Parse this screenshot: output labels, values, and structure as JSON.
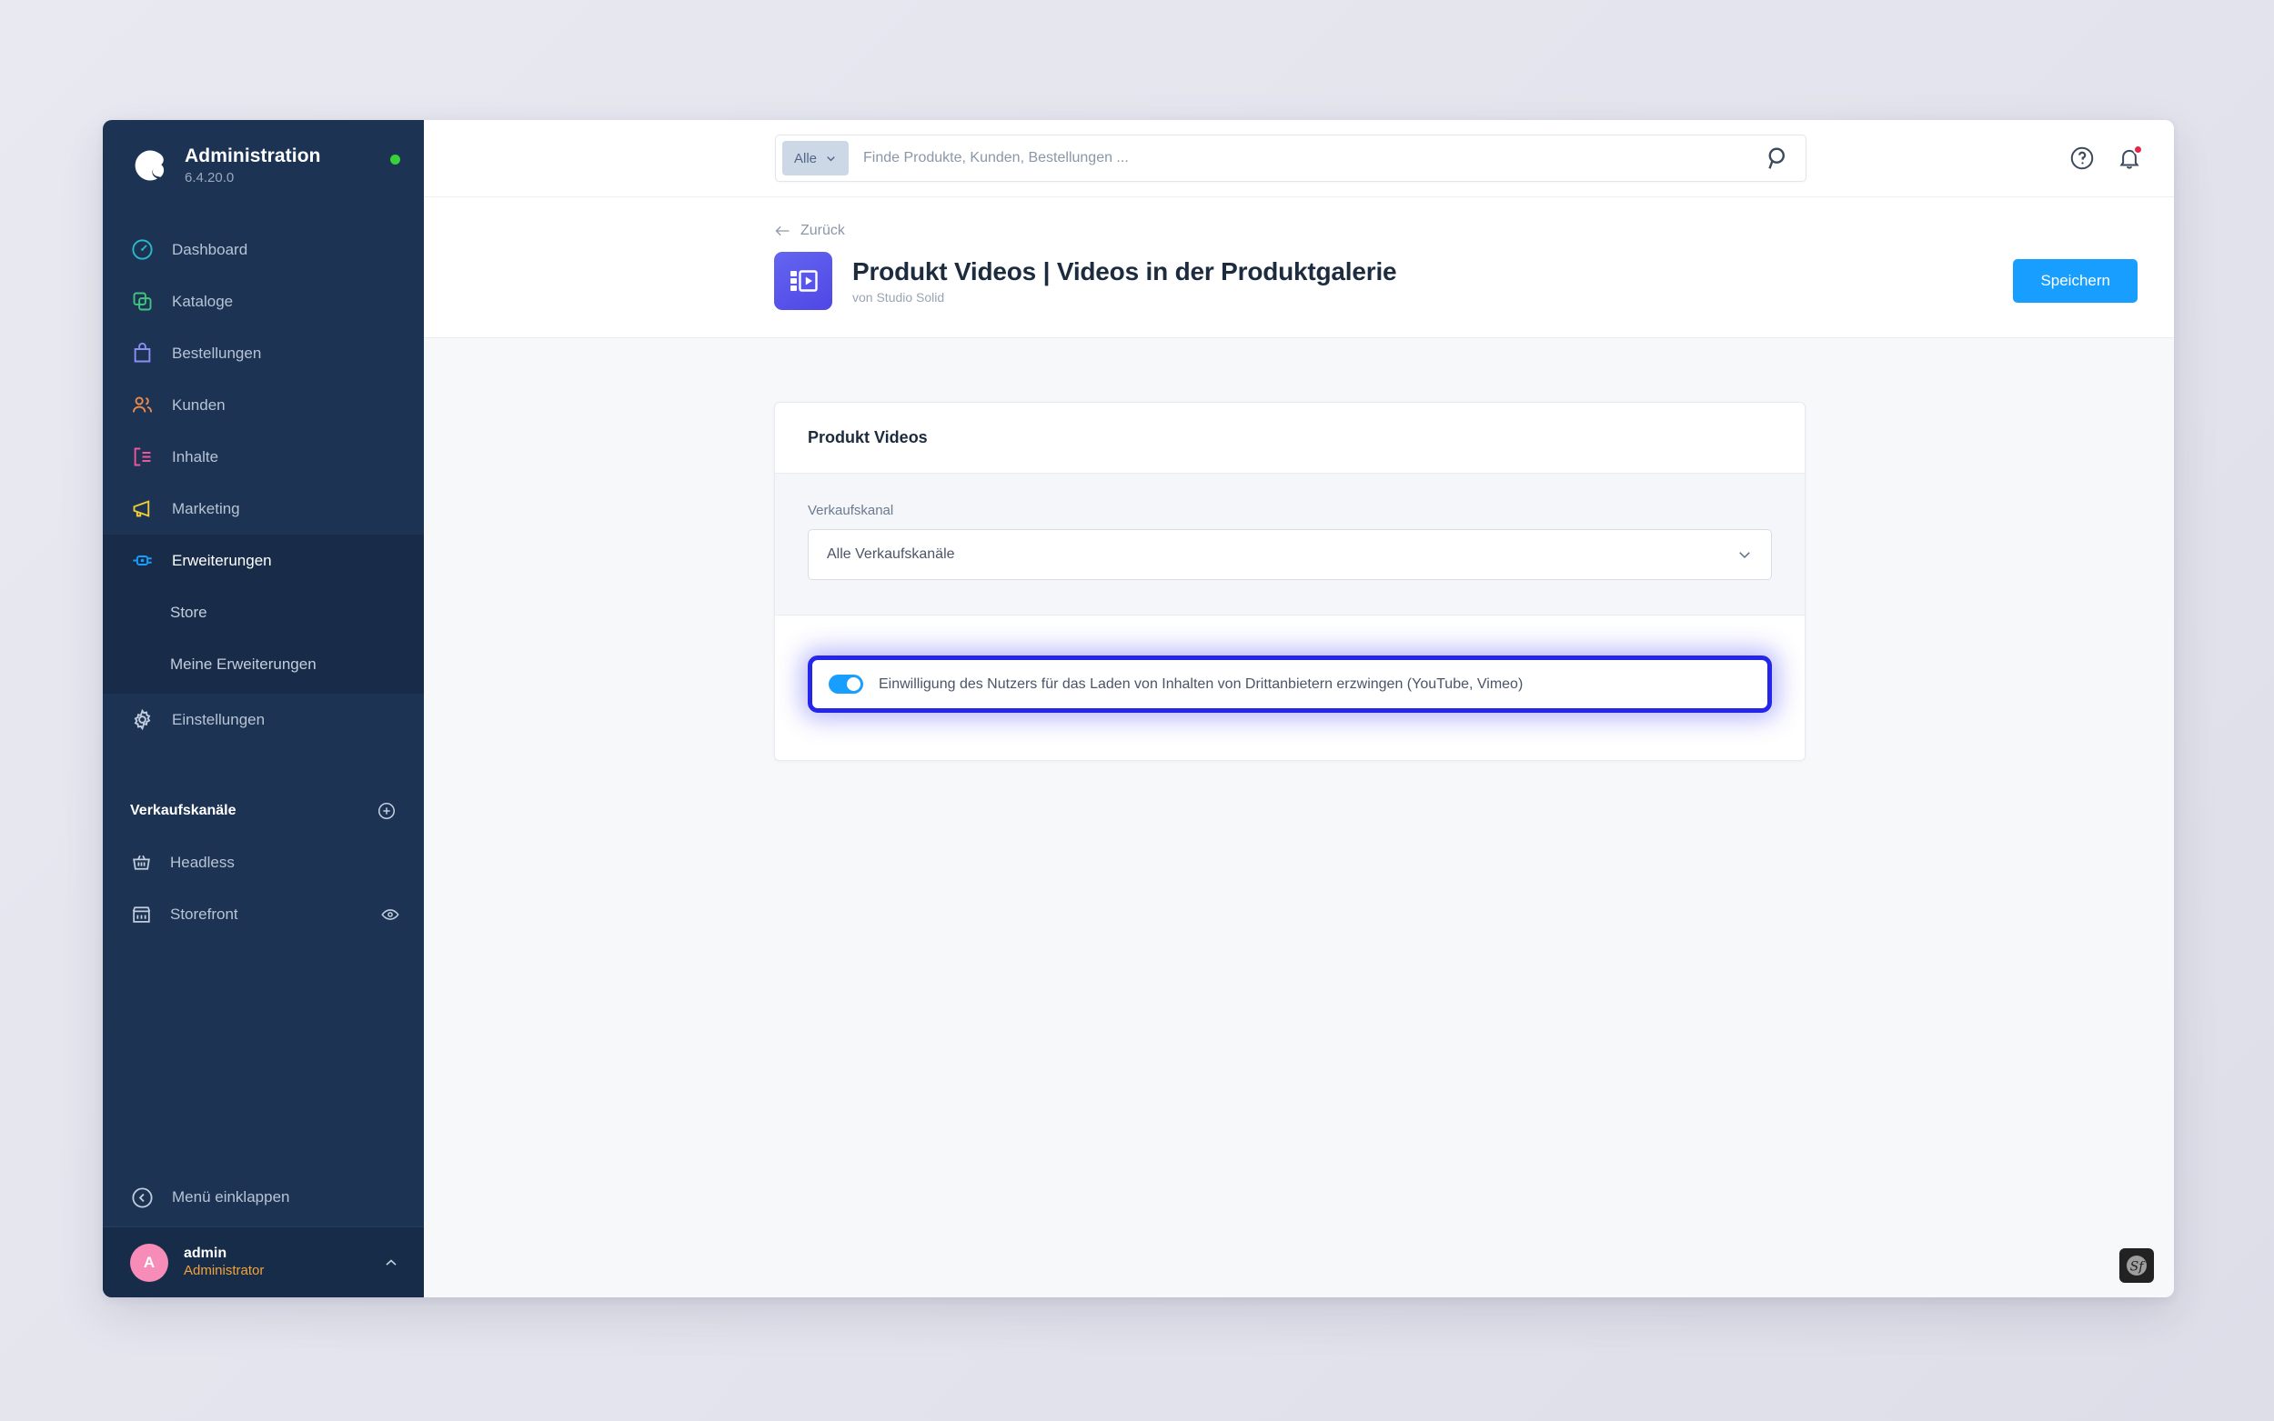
{
  "sidebar": {
    "brand": {
      "title": "Administration",
      "version": "6.4.20.0",
      "status_icon": "online-dot"
    },
    "items": [
      {
        "label": "Dashboard",
        "icon": "gauge-icon",
        "color": "#2bb7c9"
      },
      {
        "label": "Kataloge",
        "icon": "layers-icon",
        "color": "#41c47e"
      },
      {
        "label": "Bestellungen",
        "icon": "bag-icon",
        "color": "#8b8ef2"
      },
      {
        "label": "Kunden",
        "icon": "users-icon",
        "color": "#ef8b4a"
      },
      {
        "label": "Inhalte",
        "icon": "content-icon",
        "color": "#f0569b"
      },
      {
        "label": "Marketing",
        "icon": "megaphone-icon",
        "color": "#f2cc36"
      },
      {
        "label": "Erweiterungen",
        "icon": "plug-icon",
        "color": "#189eff",
        "active": true
      },
      {
        "label": "Einstellungen",
        "icon": "gear-icon",
        "color": "#c2cddd"
      }
    ],
    "sub_items": [
      {
        "label": "Store"
      },
      {
        "label": "Meine Erweiterungen"
      }
    ],
    "section": {
      "title": "Verkaufskanäle",
      "add_icon": "plus-circle-icon"
    },
    "channels": [
      {
        "label": "Headless",
        "icon": "basket-icon"
      },
      {
        "label": "Storefront",
        "icon": "store-icon",
        "action_icon": "eye-icon"
      }
    ],
    "collapse": {
      "label": "Menü einklappen",
      "icon": "chevron-left-circle-icon"
    },
    "user": {
      "initial": "A",
      "name": "admin",
      "role": "Administrator",
      "caret_icon": "chevron-up-icon"
    }
  },
  "topbar": {
    "search": {
      "scope_label": "Alle",
      "scope_icon": "chevron-down-icon",
      "placeholder": "Finde Produkte, Kunden, Bestellungen ...",
      "value": "",
      "submit_icon": "search-icon"
    },
    "help_icon": "question-circle-icon",
    "notification_icon": "bell-icon",
    "notification_badge": true
  },
  "pagehead": {
    "back_label": "Zurück",
    "back_icon": "arrow-left-icon",
    "plugin_icon": "video-gallery-icon",
    "title": "Produkt Videos | Videos in der Produktgalerie",
    "subtitle": "von Studio Solid",
    "save_label": "Speichern"
  },
  "card": {
    "heading": "Produkt Videos",
    "sales_channel": {
      "label": "Verkaufskanal",
      "value": "Alle Verkaufskanäle",
      "caret_icon": "chevron-down-icon"
    },
    "consent_toggle": {
      "label": "Einwilligung des Nutzers für das Laden von Inhalten von Drittanbietern erzwingen (YouTube, Vimeo)",
      "checked": true,
      "focused": true
    }
  },
  "debug": {
    "badge_label": "Sf",
    "badge_name": "symfony-toolbar-icon"
  },
  "colors": {
    "sidebar_bg": "#1c3354",
    "sidebar_active": "#182c49",
    "accent_blue": "#189eff",
    "focus_blue": "#2626ea",
    "avatar_pink": "#f88cb8",
    "role_orange": "#f0a33c",
    "status_green": "#37d138",
    "notification_red": "#e3274b",
    "content_bg": "#f7f8fa"
  }
}
